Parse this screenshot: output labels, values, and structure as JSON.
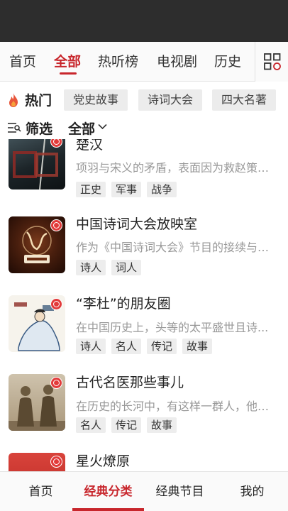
{
  "tabs": [
    {
      "label": "首页",
      "active": false
    },
    {
      "label": "全部",
      "active": true
    },
    {
      "label": "热听榜",
      "active": false
    },
    {
      "label": "电视剧",
      "active": false
    },
    {
      "label": "历史",
      "active": false
    }
  ],
  "grid_button_icon": "grid-menu-icon",
  "hot": {
    "icon": "flame-icon",
    "label": "热门",
    "tags": [
      "党史故事",
      "诗词大会",
      "四大名著"
    ]
  },
  "filter": {
    "icon": "filter-list-icon",
    "label": "筛选",
    "value": "全部",
    "chevron": "chevron-down-icon"
  },
  "programs": [
    {
      "title": "楚汉",
      "desc": "项羽与宋义的矛盾，表面因为救赵策略...",
      "tags": [
        "正史",
        "军事",
        "战争"
      ]
    },
    {
      "title": "中国诗词大会放映室",
      "desc": "作为《中国诗词大会》节目的接续与创...",
      "tags": [
        "诗人",
        "词人"
      ]
    },
    {
      "title": "“李杜”的朋友圈",
      "desc": "在中国历史上，头等的太平盛世且诗...",
      "tags": [
        "诗人",
        "名人",
        "传记",
        "故事"
      ]
    },
    {
      "title": "古代名医那些事儿",
      "desc": "在历史的长河中，有这样一群人，他们...",
      "tags": [
        "名人",
        "传记",
        "故事"
      ]
    },
    {
      "title": "星火燎原",
      "desc": "",
      "tags": []
    }
  ],
  "bottom_nav": [
    {
      "label": "首页",
      "active": false
    },
    {
      "label": "经典分类",
      "active": true
    },
    {
      "label": "经典节目",
      "active": false
    },
    {
      "label": "我的",
      "active": false
    }
  ],
  "colors": {
    "accent": "#c8262c",
    "status_bar": "#2d2d2d",
    "tag_bg": "#ececec"
  }
}
